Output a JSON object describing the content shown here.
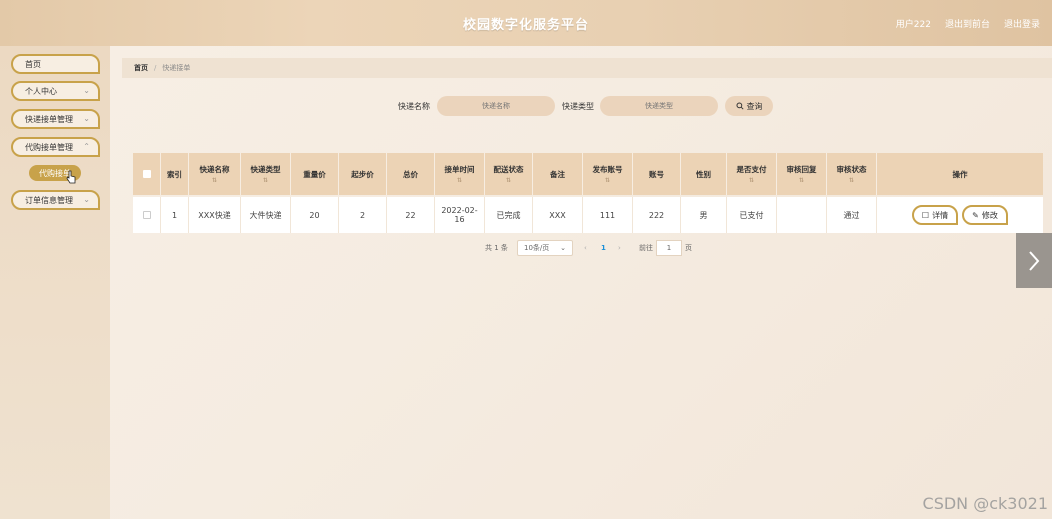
{
  "header": {
    "title": "校园数字化服务平台",
    "user": "用户222",
    "exit_backend": "退出到前台",
    "logout": "退出登录"
  },
  "sidebar": {
    "items": [
      {
        "label": "首页",
        "has_chevron": false
      },
      {
        "label": "个人中心",
        "has_chevron": true
      },
      {
        "label": "快递接单管理",
        "has_chevron": true
      },
      {
        "label": "代购接单管理",
        "has_chevron": true
      },
      {
        "label": "订单信息管理",
        "has_chevron": true
      }
    ],
    "active_sub": "代购接单"
  },
  "breadcrumb": {
    "home": "首页",
    "separator": "/",
    "current": "快递接单"
  },
  "search": {
    "name_label": "快递名称",
    "name_placeholder": "快递名称",
    "type_label": "快递类型",
    "type_placeholder": "快递类型",
    "query_button": "查询"
  },
  "table": {
    "columns": [
      "索引",
      "快递名称",
      "快递类型",
      "重量价",
      "起步价",
      "总价",
      "接单时间",
      "配送状态",
      "备注",
      "发布账号",
      "账号",
      "性别",
      "是否支付",
      "审核回复",
      "审核状态",
      "操作"
    ],
    "rows": [
      {
        "index": "1",
        "name": "XXX快递",
        "type": "大件快递",
        "weight_price": "20",
        "start_price": "2",
        "total": "22",
        "time_line1": "2022-02-",
        "time_line2": "16",
        "status": "已完成",
        "remark": "XXX",
        "publisher": "111",
        "account": "222",
        "gender": "男",
        "paid": "已支付",
        "reply": "",
        "review": "通过",
        "detail_btn": "详情",
        "edit_btn": "修改"
      }
    ]
  },
  "pagination": {
    "total": "共 1 条",
    "page_size": "10条/页",
    "current_page": "1",
    "goto_label": "前往",
    "goto_value": "1",
    "page_unit": "页"
  },
  "watermark": "CSDN @ck3021",
  "colors": {
    "accent": "#c8a24a",
    "header_bg": "#e3c9a8",
    "table_header": "#ecd3b5"
  }
}
